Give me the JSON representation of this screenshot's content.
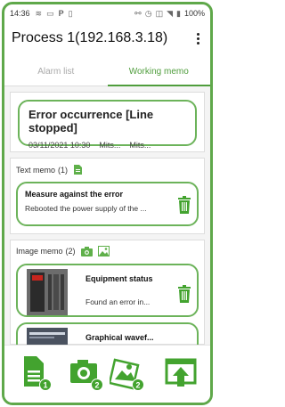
{
  "statusbar": {
    "time": "14:36",
    "battery": "100%"
  },
  "header": {
    "title": "Process 1(192.168.3.18)"
  },
  "tabs": [
    {
      "label": "Alarm list",
      "active": false
    },
    {
      "label": "Working memo",
      "active": true
    }
  ],
  "alarm": {
    "title": "Error occurrence [Line stopped]",
    "date": "03/11/2021 10:30",
    "field1": "Mits...",
    "field2": "Mits..."
  },
  "text_memo": {
    "label": "Text memo",
    "count": "(1)",
    "items": [
      {
        "title": "Measure against the error",
        "body": "Rebooted the power supply of the ..."
      }
    ]
  },
  "image_memo": {
    "label": "Image memo",
    "count": "(2)",
    "items": [
      {
        "title": "Equipment status",
        "body": "Found an error in..."
      },
      {
        "title": "Graphical wavef...",
        "body": ""
      }
    ]
  },
  "actions": [
    {
      "name": "text-memo-action",
      "badge": "1"
    },
    {
      "name": "camera-action",
      "badge": "2"
    },
    {
      "name": "image-action",
      "badge": "2"
    },
    {
      "name": "upload-action",
      "badge": ""
    }
  ],
  "colors": {
    "accent": "#4f9d3c",
    "border": "#6cb35a",
    "trash": "#43a32f"
  }
}
